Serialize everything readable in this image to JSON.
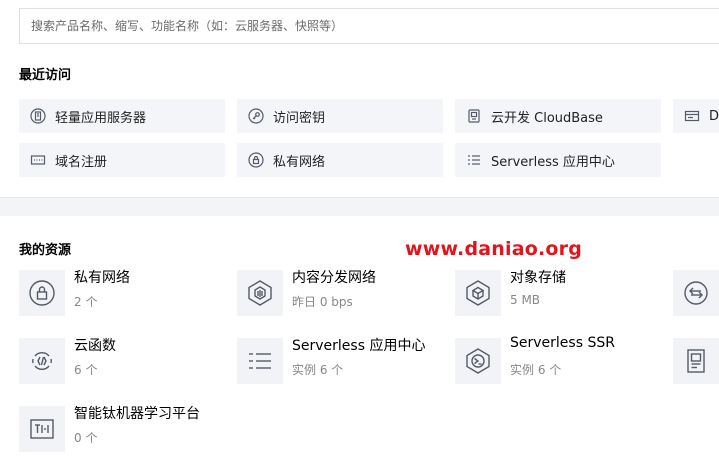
{
  "search": {
    "placeholder": "搜索产品名称、缩写、功能名称（如：云服务器、快照等）"
  },
  "recent": {
    "title": "最近访问",
    "items": [
      {
        "label": "轻量应用服务器",
        "icon": "lighthouse-icon"
      },
      {
        "label": "访问密钥",
        "icon": "key-icon"
      },
      {
        "label": "云开发 CloudBase",
        "icon": "cloudbase-icon"
      },
      {
        "label": "Dl",
        "icon": "dns-icon"
      },
      {
        "label": "域名注册",
        "icon": "domain-icon"
      },
      {
        "label": "私有网络",
        "icon": "vpc-icon"
      },
      {
        "label": "Serverless 应用中心",
        "icon": "list-icon"
      }
    ]
  },
  "resources": {
    "title": "我的资源",
    "items": [
      {
        "name": "私有网络",
        "value": "2 个",
        "icon": "vpc-icon"
      },
      {
        "name": "内容分发网络",
        "value": "昨日 0 bps",
        "icon": "cdn-icon"
      },
      {
        "name": "对象存储",
        "value": "5 MB",
        "icon": "cos-icon"
      },
      {
        "name": "",
        "value": "",
        "icon": "transfer-icon"
      },
      {
        "name": "云函数",
        "value": "6 个",
        "icon": "scf-icon"
      },
      {
        "name": "Serverless 应用中心",
        "value": "实例 6 个",
        "icon": "list-icon"
      },
      {
        "name": "Serverless SSR",
        "value": "实例 6 个",
        "icon": "ssr-icon"
      },
      {
        "name": "",
        "value": "",
        "icon": "document-icon"
      },
      {
        "name": "智能钛机器学习平台",
        "value": "0 个",
        "icon": "ti-icon"
      }
    ]
  },
  "watermark": "www.daniao.org",
  "colors": {
    "watermark": "#e0161e",
    "icon": "#555a66",
    "chip_bg": "#f3f5f9"
  }
}
